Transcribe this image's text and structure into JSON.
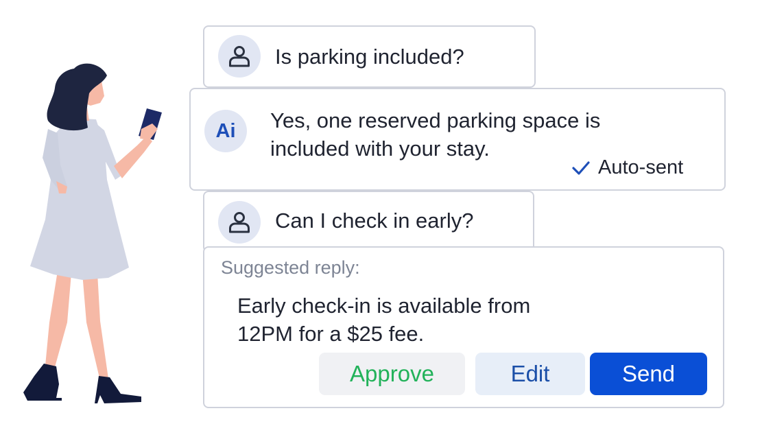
{
  "messages": [
    {
      "role": "guest",
      "icon": "user-icon",
      "text": "Is parking included?"
    },
    {
      "role": "ai",
      "avatar_label": "Ai",
      "lines": [
        "Yes, one reserved parking space is",
        "included with your stay."
      ],
      "status": {
        "icon": "checkmark-icon",
        "label": "Auto-sent"
      }
    },
    {
      "role": "guest",
      "icon": "user-icon",
      "text": "Can I check in early?"
    }
  ],
  "suggestion": {
    "label": "Suggested reply:",
    "lines": [
      "Early check-in is available from",
      "12PM for a $25 fee."
    ],
    "buttons": {
      "approve": "Approve",
      "edit": "Edit",
      "send": "Send"
    }
  },
  "colors": {
    "accent": "#0a4fd6",
    "approve_text": "#22b25a",
    "avatar_bg": "#e1e6f3",
    "border": "#cfd2dc"
  }
}
